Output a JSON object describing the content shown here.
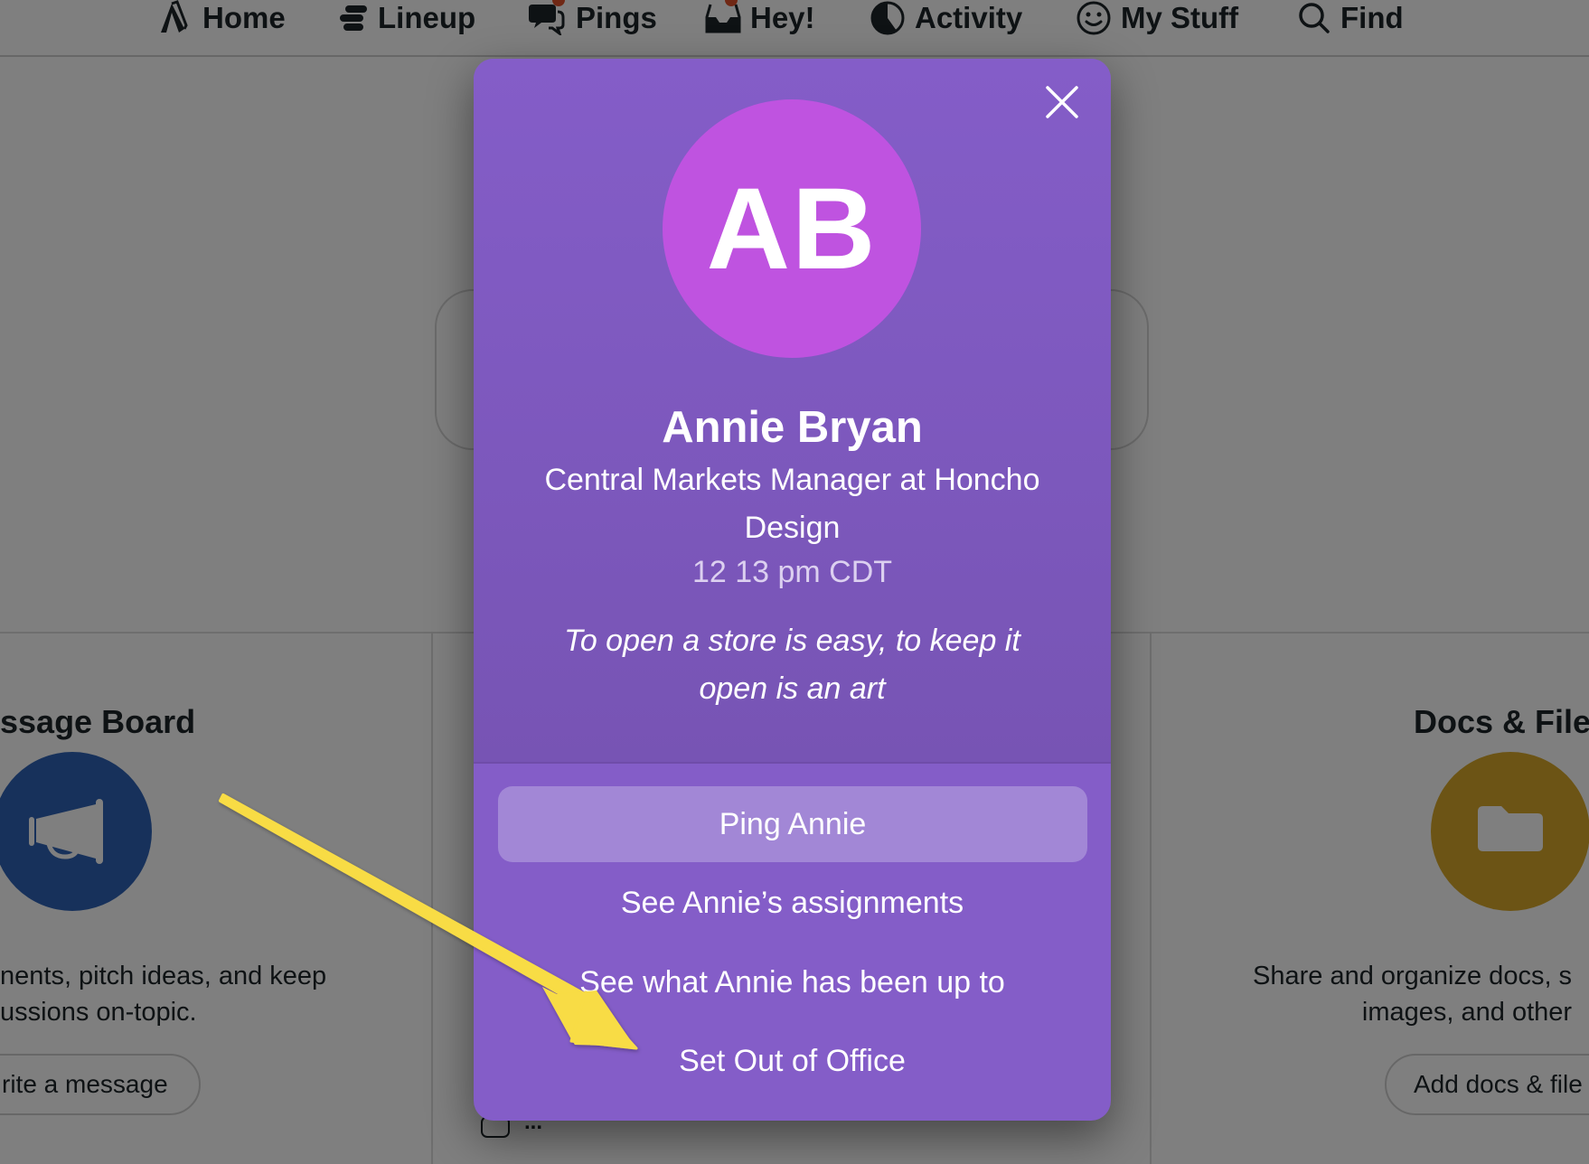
{
  "nav": {
    "items": [
      {
        "label": "Home",
        "icon": "home-tent-icon",
        "badge": false
      },
      {
        "label": "Lineup",
        "icon": "lineup-icon",
        "badge": false
      },
      {
        "label": "Pings",
        "icon": "chat-bubbles-icon",
        "badge": true
      },
      {
        "label": "Hey!",
        "icon": "inbox-tray-icon",
        "badge": true
      },
      {
        "label": "Activity",
        "icon": "pie-clock-icon",
        "badge": false
      },
      {
        "label": "My Stuff",
        "icon": "smiley-icon",
        "badge": false
      },
      {
        "label": "Find",
        "icon": "search-icon",
        "badge": false
      }
    ],
    "badge_color": "#e0512b"
  },
  "background": {
    "cards": [
      {
        "title": "Message Board",
        "title_visible": "ssage Board",
        "icon": "megaphone-icon",
        "icon_color": "#2f63b6",
        "desc_line1": "nents, pitch ideas, and keep",
        "desc_line2": "ussions on-topic.",
        "button": "rite a message"
      },
      {
        "title": "Docs & Files",
        "title_visible": "Docs & File",
        "icon": "folder-icon",
        "icon_color": "#d9a92a",
        "desc_line1": "Share and organize docs, s",
        "desc_line2": "images, and other",
        "button": "Add docs & file"
      }
    ],
    "todo_dots": "..."
  },
  "profile": {
    "initials": "AB",
    "avatar_color": "#bf53e0",
    "name": "Annie Bryan",
    "title": "Central Markets Manager at Honcho Design",
    "local_time": "12 13 pm CDT",
    "quote": "To open a store is easy, to keep it open is an art",
    "accent_color": "#845dc8",
    "actions": {
      "ping": "Ping Annie",
      "assignments": "See Annie’s assignments",
      "activity": "See what Annie has been up to",
      "out_of_office": "Set Out of Office"
    },
    "close_icon": "close-icon"
  },
  "annotation": {
    "arrow_color": "#f8dc44",
    "points_to": "Set Out of Office"
  }
}
